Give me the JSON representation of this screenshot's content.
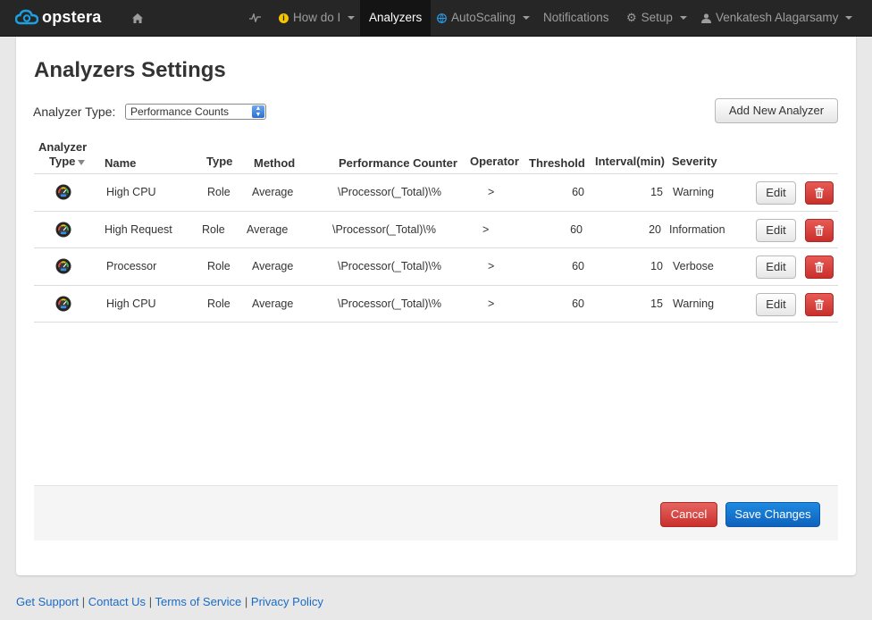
{
  "brand": {
    "name": "opstera"
  },
  "nav": {
    "home_icon": "home-icon",
    "pulse_icon": "pulse-icon",
    "how_do_i": "How do I",
    "analyzers": "Analyzers",
    "autoscaling": "AutoScaling",
    "notifications": "Notifications",
    "setup": "Setup",
    "user": "Venkatesh Alagarsamy"
  },
  "page": {
    "title": "Analyzers Settings",
    "type_label": "Analyzer Type:",
    "type_value": "Performance Counts",
    "add_button": "Add New Analyzer"
  },
  "table": {
    "headers": {
      "analyzer": "Analyzer",
      "type_col": "Type",
      "name": "Name",
      "type": "Type",
      "method": "Method",
      "counter": "Performance Counter",
      "operator": "Operator",
      "threshold": "Threshold",
      "interval": "Interval(min)",
      "severity": "Severity"
    },
    "edit_label": "Edit",
    "rows": [
      {
        "name": "High CPU",
        "type": "Role",
        "method": "Average",
        "counter": "\\Processor(_Total)\\%",
        "operator": ">",
        "threshold": "60",
        "interval": "15",
        "severity": "Warning"
      },
      {
        "name": "High Request",
        "type": "Role",
        "method": "Average",
        "counter": "\\Processor(_Total)\\%",
        "operator": ">",
        "threshold": "60",
        "interval": "20",
        "severity": "Information"
      },
      {
        "name": "Processor",
        "type": "Role",
        "method": "Average",
        "counter": "\\Processor(_Total)\\%",
        "operator": ">",
        "threshold": "60",
        "interval": "10",
        "severity": "Verbose"
      },
      {
        "name": "High CPU",
        "type": "Role",
        "method": "Average",
        "counter": "\\Processor(_Total)\\%",
        "operator": ">",
        "threshold": "60",
        "interval": "15",
        "severity": "Warning"
      }
    ]
  },
  "actions": {
    "cancel": "Cancel",
    "save": "Save Changes"
  },
  "footer": {
    "support": "Get Support",
    "contact": "Contact Us",
    "terms": "Terms of Service",
    "privacy": "Privacy Policy",
    "sep": "|"
  },
  "colors": {
    "nav_bg": "#262626",
    "brand_blue": "#1ba1e2",
    "danger": "#c9302c",
    "primary": "#0d62bd"
  }
}
